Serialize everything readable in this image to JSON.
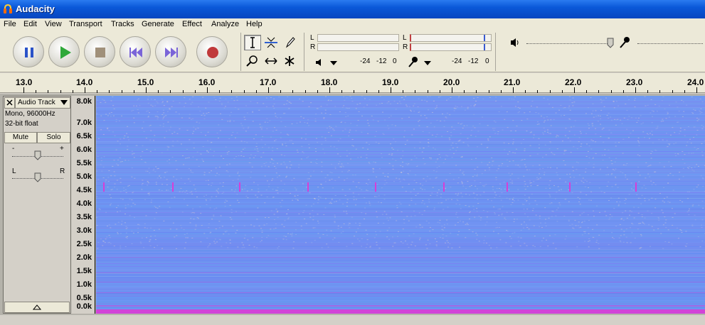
{
  "window": {
    "title": "Audacity"
  },
  "menu": [
    "File",
    "Edit",
    "View",
    "Transport",
    "Tracks",
    "Generate",
    "Effect",
    "Analyze",
    "Help"
  ],
  "transport": {
    "pause": "pause-icon",
    "play": "play-icon",
    "stop": "stop-icon",
    "skip_start": "skip-to-start-icon",
    "skip_end": "skip-to-end-icon",
    "record": "record-icon"
  },
  "meters": {
    "left_label": "L",
    "right_label": "R",
    "scale_a": [
      "-24",
      "-12",
      "0"
    ],
    "scale_b": [
      "-24",
      "-12",
      "0"
    ]
  },
  "ruler": {
    "labels": [
      "13.0",
      "14.0",
      "15.0",
      "16.0",
      "17.0",
      "18.0",
      "19.0",
      "20.0",
      "21.0",
      "22.0",
      "23.0",
      "24.0"
    ]
  },
  "track": {
    "name": "Audio Track",
    "info_line1": "Mono, 96000Hz",
    "info_line2": "32-bit float",
    "mute": "Mute",
    "solo": "Solo",
    "gain_minus": "-",
    "gain_plus": "+",
    "pan_left": "L",
    "pan_right": "R"
  },
  "freq_axis": [
    "8.0k",
    "7.0k",
    "6.5k",
    "6.0k",
    "5.5k",
    "5.0k",
    "4.5k",
    "4.0k",
    "3.5k",
    "3.0k",
    "2.5k",
    "2.0k",
    "1.5k",
    "1.0k",
    "0.5k",
    "0.0k"
  ],
  "colors": {
    "spectrogram_base": "#6f92f0",
    "accent_pink": "#d63fd6",
    "titlebar": "#0a58d8"
  }
}
